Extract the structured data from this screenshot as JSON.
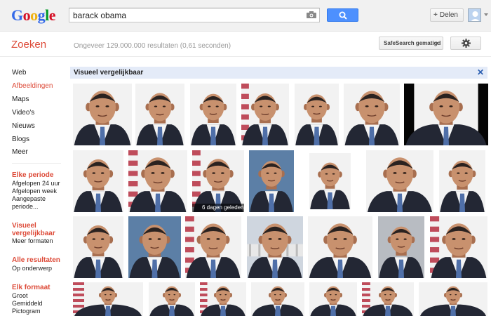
{
  "header": {
    "logo_letters": [
      {
        "char": "G",
        "color": "#3369e8"
      },
      {
        "char": "o",
        "color": "#d50f25"
      },
      {
        "char": "o",
        "color": "#eeb211"
      },
      {
        "char": "g",
        "color": "#3369e8"
      },
      {
        "char": "l",
        "color": "#009925"
      },
      {
        "char": "e",
        "color": "#d50f25"
      }
    ],
    "search_value": "barack obama",
    "share_label": "Delen",
    "camera_icon": "camera-icon",
    "search_icon": "magnifier-icon"
  },
  "subheader": {
    "title": "Zoeken",
    "result_stats": "Ongeveer 129.000.000 resultaten (0,61 seconden)",
    "safesearch_label": "SafeSearch gematigd",
    "settings_icon": "gear-icon"
  },
  "sidebar": {
    "nav": [
      {
        "label": "Web",
        "active": false
      },
      {
        "label": "Afbeeldingen",
        "active": true
      },
      {
        "label": "Maps",
        "active": false
      },
      {
        "label": "Video's",
        "active": false
      },
      {
        "label": "Nieuws",
        "active": false
      },
      {
        "label": "Blogs",
        "active": false
      },
      {
        "label": "Meer",
        "active": false
      }
    ],
    "period": {
      "heading": "Elke periode",
      "options": [
        "Afgelopen 24 uur",
        "Afgelopen week",
        "Aangepaste",
        "periode..."
      ]
    },
    "similar": {
      "heading_lines": [
        "Visueel",
        "vergelijkbaar"
      ],
      "options": [
        "Meer formaten"
      ]
    },
    "results": {
      "heading": "Alle resultaten",
      "options": [
        "Op onderwerp"
      ]
    },
    "format": {
      "heading": "Elk formaat",
      "options": [
        "Groot",
        "Gemiddeld",
        "Pictogram"
      ]
    }
  },
  "banner": {
    "label": "Visueel vergelijkbaar",
    "close_glyph": "✕"
  },
  "grid": {
    "row1_captions": [],
    "row2_caption": "6 dagen geleden",
    "colors": {
      "skin": "#c8916e",
      "skin_shadow": "#a86f50",
      "hair": "#2a2220",
      "suit": "#232734",
      "shirt": "#f4f4f4",
      "tie_blue": "#4f6fa8",
      "bg_white": "#f2f2f2",
      "bg_blue": "#5c7fa6",
      "bg_grey": "#b8bcc2",
      "flag_red": "#b22234"
    }
  }
}
